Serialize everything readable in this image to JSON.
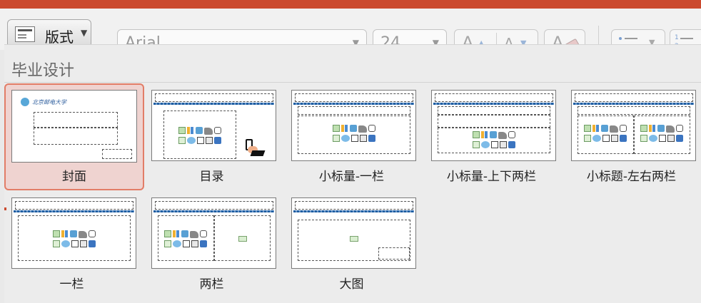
{
  "toolbar": {
    "layout_button": "版式",
    "font_name": "Arial",
    "font_size": "24",
    "grow_font_glyph": "A",
    "shrink_font_glyph": "A",
    "clear_format_glyph": "A",
    "accent_color": "#cb4a2f"
  },
  "gallery": {
    "section_title": "毕业设计",
    "logo_text": "北京邮电大学",
    "selected_layout": "封面",
    "layouts": [
      {
        "label": "封面",
        "selected": true
      },
      {
        "label": "目录",
        "selected": false
      },
      {
        "label": "小标量-一栏",
        "selected": false
      },
      {
        "label": "小标量-上下两栏",
        "selected": false
      },
      {
        "label": "小标题-左右两栏",
        "selected": false
      },
      {
        "label": "一栏",
        "selected": false
      },
      {
        "label": "两栏",
        "selected": false
      },
      {
        "label": "大图",
        "selected": false
      }
    ]
  }
}
